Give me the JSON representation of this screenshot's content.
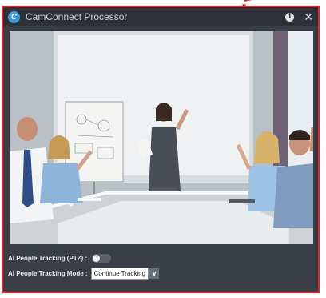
{
  "window": {
    "title": "CamConnect Processor",
    "logo_letter": "C",
    "info_glyph": "i",
    "close_glyph": "✕"
  },
  "video": {
    "description_icon": "camera-feed"
  },
  "controls": {
    "ptz_label": "AI People Tracking (PTZ) :",
    "ptz_enabled": false,
    "mode_label": "AI People Tracking Mode :",
    "mode_value": "Continue Tracking",
    "mode_arrow": "∨"
  },
  "colors": {
    "accent_border": "#e8202a",
    "panel_bg": "#3a3f47",
    "logo_blue": "#3b9bd8"
  }
}
